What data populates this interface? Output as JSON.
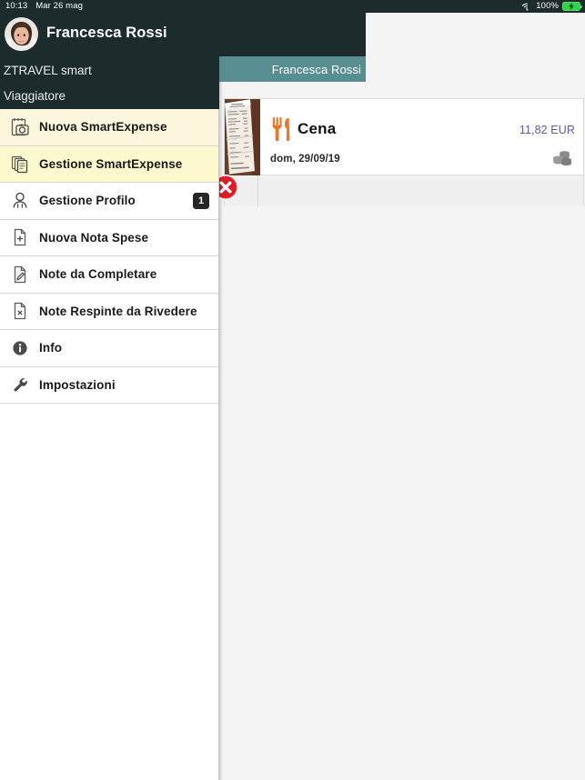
{
  "statusbar": {
    "time": "10:13",
    "date": "Mar 26 mag",
    "battery_pct": "100%",
    "wifi_icon": "wifi-icon",
    "battery_icon": "battery-charging-icon"
  },
  "header": {
    "user_name": "Francesca Rossi",
    "brand": "ZTRAVEL smart",
    "role": "Viaggiatore",
    "avatar_icon": "avatar"
  },
  "navbar": {
    "title": "Francesca Rossi"
  },
  "sidebar": {
    "items": [
      {
        "label": "Nuova SmartExpense",
        "icon": "document-camera-icon",
        "style": "hl-a",
        "badge": ""
      },
      {
        "label": "Gestione SmartExpense",
        "icon": "document-stack-icon",
        "style": "hl-b",
        "badge": ""
      },
      {
        "label": "Gestione Profilo",
        "icon": "person-icon",
        "style": "plain",
        "badge": "1"
      },
      {
        "label": "Nuova Nota Spese",
        "icon": "document-plus-icon",
        "style": "plain",
        "badge": ""
      },
      {
        "label": "Note da Completare",
        "icon": "document-pencil-icon",
        "style": "plain",
        "badge": ""
      },
      {
        "label": "Note Respinte da Rivedere",
        "icon": "document-x-icon",
        "style": "plain",
        "badge": ""
      },
      {
        "label": "Info",
        "icon": "info-icon",
        "style": "plain",
        "badge": ""
      },
      {
        "label": "Impostazioni",
        "icon": "wrench-icon",
        "style": "plain",
        "badge": ""
      }
    ]
  },
  "expense": {
    "title": "Cena",
    "amount": "11,82 EUR",
    "date": "dom, 29/09/19",
    "category_icon": "fork-knife-icon",
    "receipt_icon": "receipt-thumbnail",
    "payment_icon": "coins-icon",
    "delete_icon": "delete-circle-icon"
  },
  "colors": {
    "status_bar": "#1c2b2b",
    "navbar_teal": "#588e92",
    "amount_text": "#5b5ba8",
    "category_orange": "#ef7724",
    "delete_red": "#e01b24",
    "highlight_a": "#fcf7dc",
    "highlight_b": "#fcf9cf",
    "badge_dark": "#262626"
  }
}
